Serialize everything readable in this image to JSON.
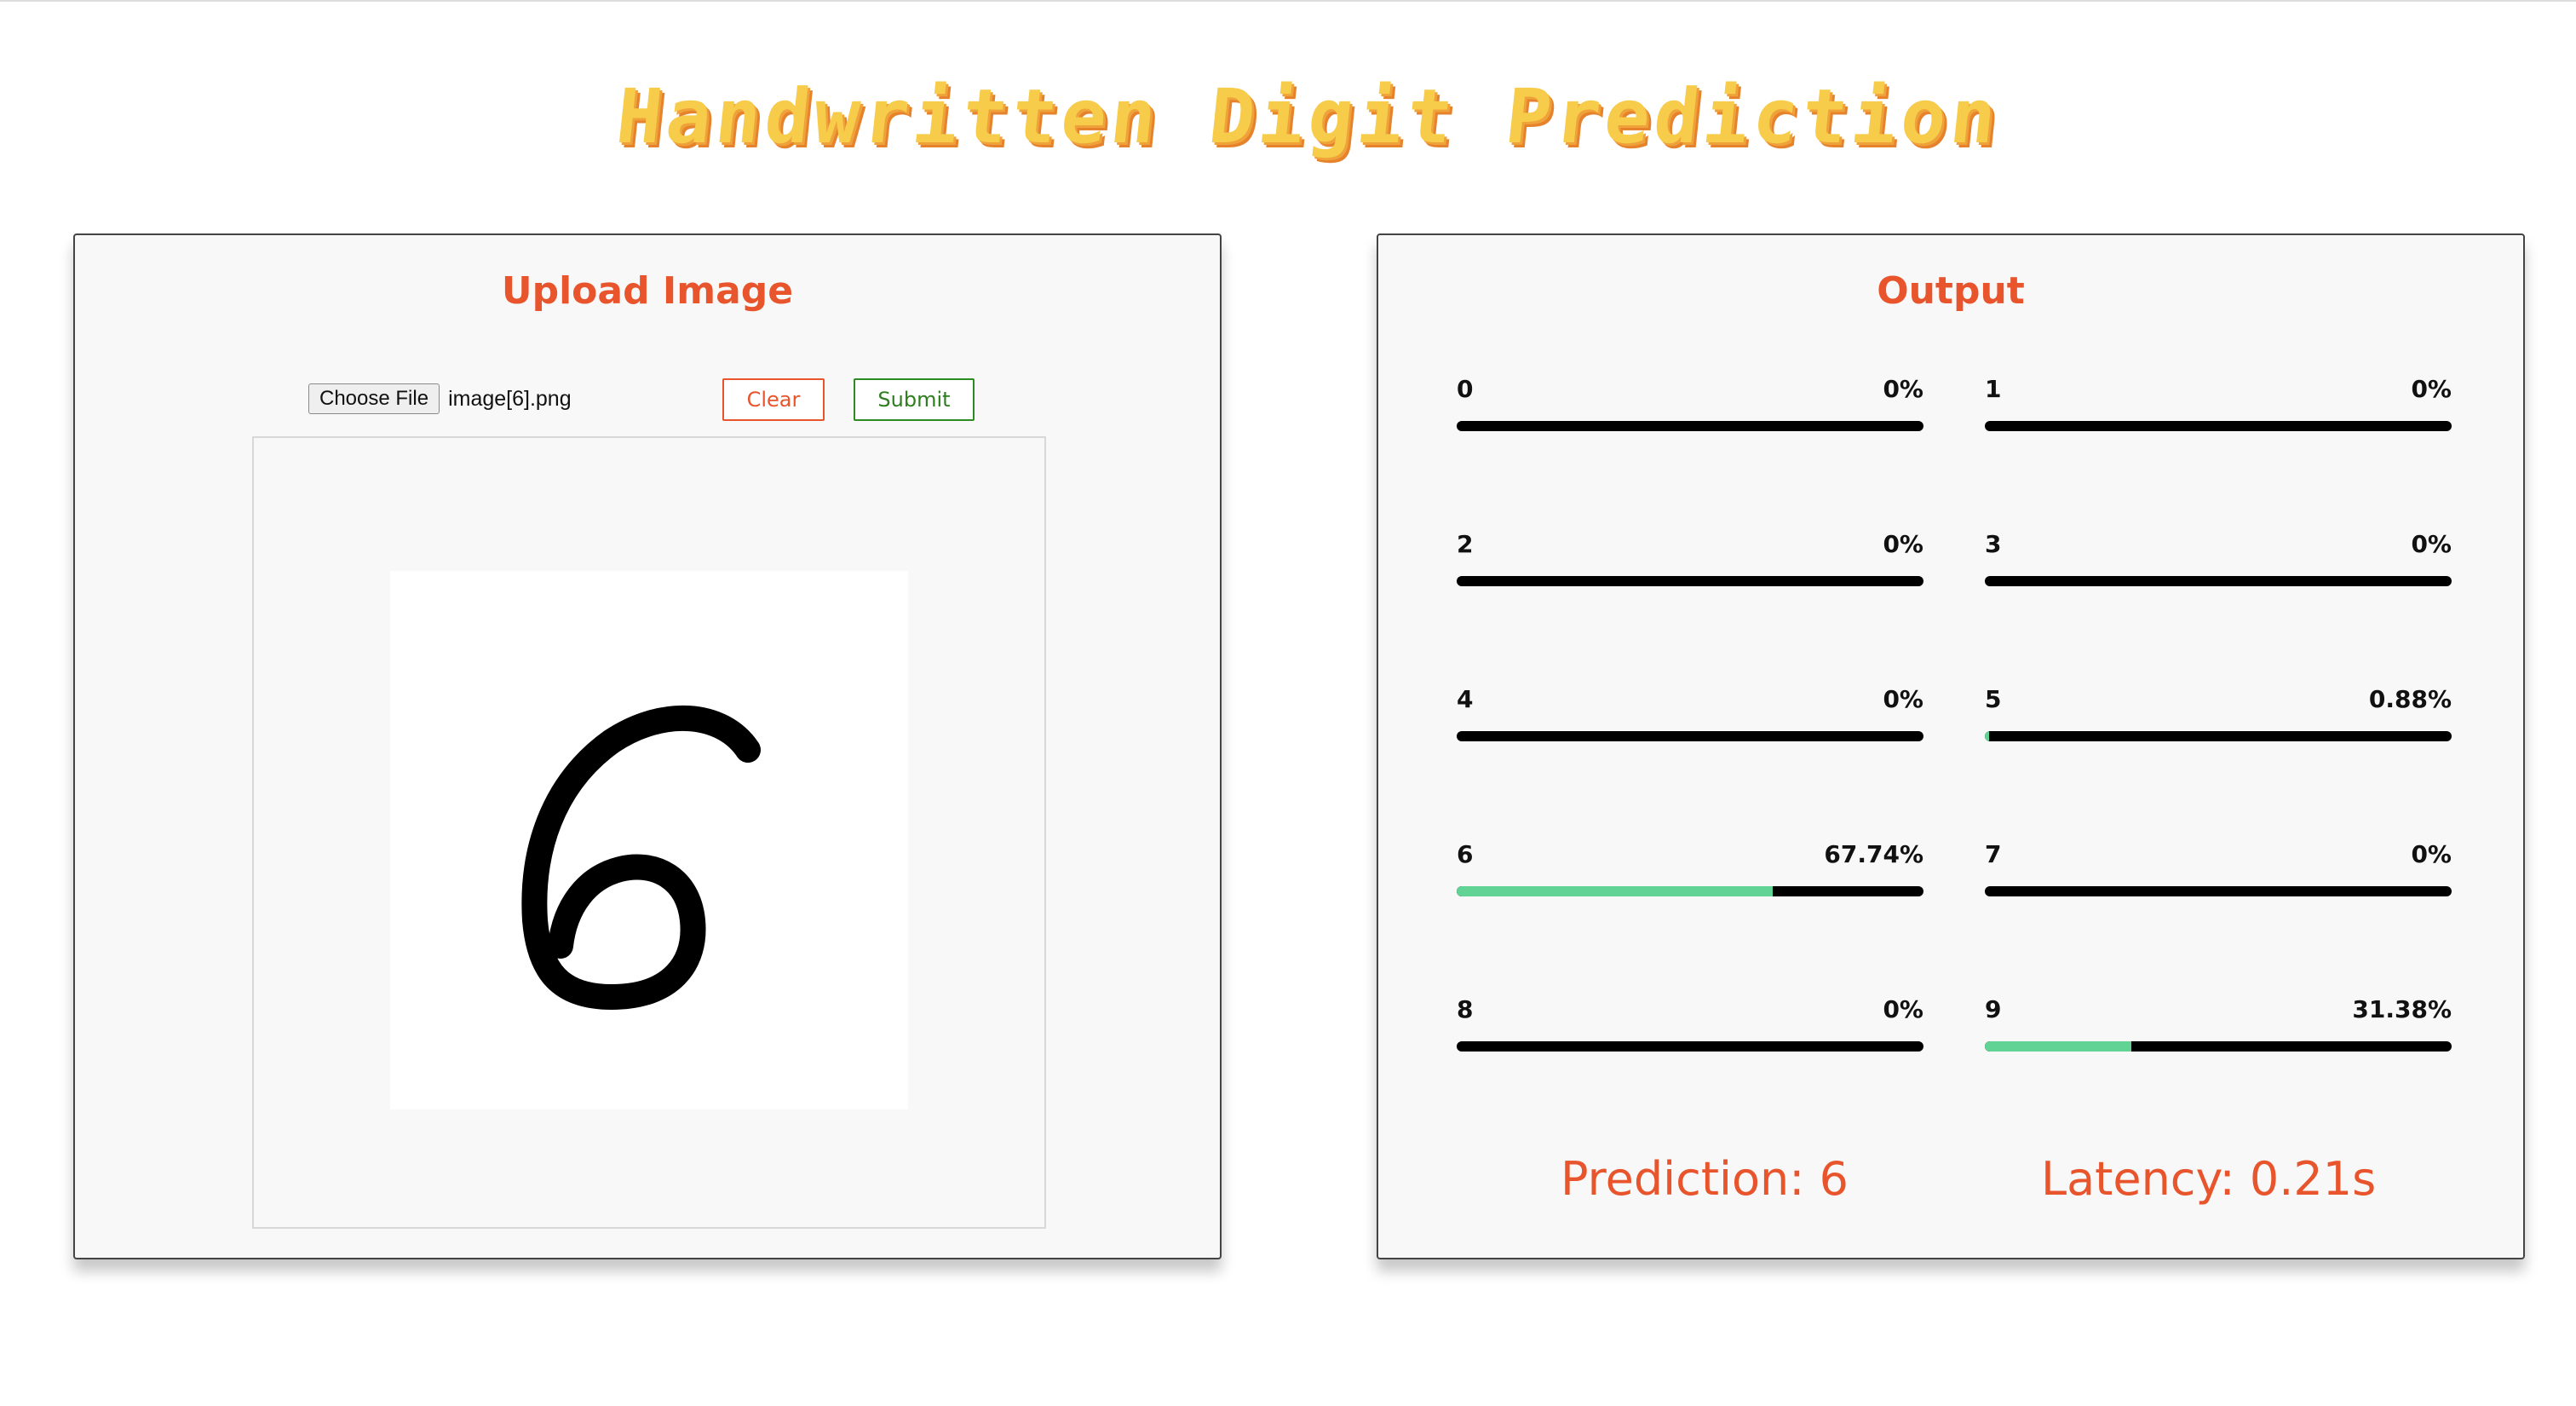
{
  "app": {
    "title": "Handwritten Digit Prediction"
  },
  "colors": {
    "accent": "#e8542b",
    "submit": "#2e8b22",
    "bar_fill": "#61d394",
    "bar_track": "#000000",
    "title_gold": "#f6cc4a"
  },
  "upload": {
    "title": "Upload Image",
    "choose_file_label": "Choose File",
    "file_name": "image[6].png",
    "clear_label": "Clear",
    "submit_label": "Submit",
    "preview_digit": "6"
  },
  "output": {
    "title": "Output",
    "probabilities": [
      {
        "digit": "0",
        "value": "0%",
        "fraction": 0.0
      },
      {
        "digit": "1",
        "value": "0%",
        "fraction": 0.0
      },
      {
        "digit": "2",
        "value": "0%",
        "fraction": 0.0
      },
      {
        "digit": "3",
        "value": "0%",
        "fraction": 0.0
      },
      {
        "digit": "4",
        "value": "0%",
        "fraction": 0.0
      },
      {
        "digit": "5",
        "value": "0.88%",
        "fraction": 0.0088
      },
      {
        "digit": "6",
        "value": "67.74%",
        "fraction": 0.6774
      },
      {
        "digit": "7",
        "value": "0%",
        "fraction": 0.0
      },
      {
        "digit": "8",
        "value": "0%",
        "fraction": 0.0
      },
      {
        "digit": "9",
        "value": "31.38%",
        "fraction": 0.3138
      }
    ],
    "prediction_text": "Prediction: 6",
    "latency_text": "Latency: 0.21s"
  }
}
